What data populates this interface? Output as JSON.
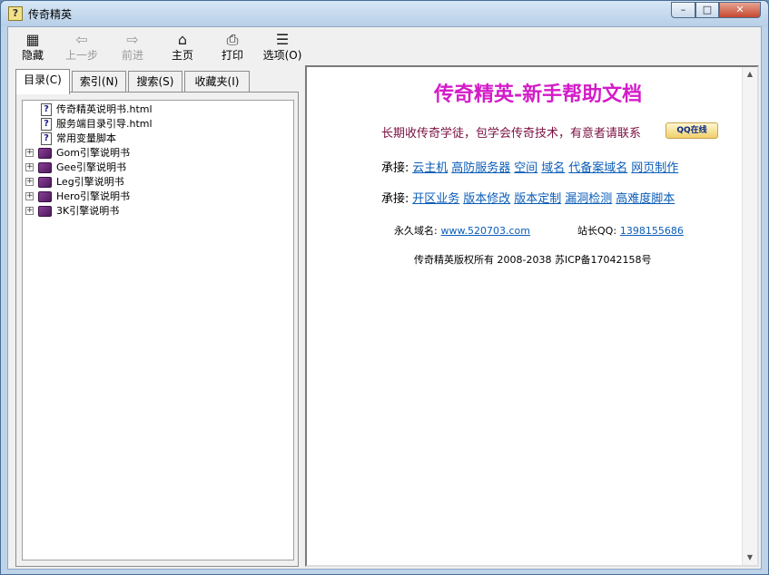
{
  "window": {
    "title": "传奇精英"
  },
  "toolbar": {
    "buttons": [
      {
        "label": "隐藏",
        "icon": "hide-pane-icon"
      },
      {
        "label": "上一步",
        "icon": "back-arrow-icon"
      },
      {
        "label": "前进",
        "icon": "forward-arrow-icon"
      },
      {
        "label": "主页",
        "icon": "home-icon"
      },
      {
        "label": "打印",
        "icon": "print-icon"
      },
      {
        "label": "选项(O)",
        "icon": "options-icon"
      }
    ]
  },
  "tabs": [
    {
      "label": "目录(C)"
    },
    {
      "label": "索引(N)"
    },
    {
      "label": "搜索(S)"
    },
    {
      "label": "收藏夹(I)"
    }
  ],
  "tree": [
    {
      "label": "传奇精英说明书.html",
      "icon": "help-page-icon",
      "expandable": false
    },
    {
      "label": "服务端目录引导.html",
      "icon": "help-page-icon",
      "expandable": false
    },
    {
      "label": "常用变量脚本",
      "icon": "help-page-icon",
      "expandable": false
    },
    {
      "label": "Gom引擎说明书",
      "icon": "book-icon",
      "expandable": true
    },
    {
      "label": "Gee引擎说明书",
      "icon": "book-icon",
      "expandable": true
    },
    {
      "label": "Leg引擎说明书",
      "icon": "book-icon",
      "expandable": true
    },
    {
      "label": "Hero引擎说明书",
      "icon": "book-icon",
      "expandable": true
    },
    {
      "label": "3K引擎说明书",
      "icon": "book-icon",
      "expandable": true
    }
  ],
  "content": {
    "heading": "传奇精英-新手帮助文档",
    "recruit_text": "长期收传奇学徒，包学会传奇技术，有意者请联系",
    "qq_badge": "QQ在线",
    "service_label": "承接:",
    "service_links_1": [
      "云主机",
      "高防服务器",
      "空间",
      "域名",
      "代备案域名",
      "网页制作"
    ],
    "service_links_2": [
      "开区业务",
      "版本修改",
      "版本定制",
      "漏洞检测",
      "高难度脚本"
    ],
    "domain_label": "永久域名:",
    "domain_value": "www.520703.com",
    "qq_label": "站长QQ:",
    "qq_value": "1398155686",
    "copyright": "传奇精英版权所有 2008-2038 苏ICP备17042158号"
  }
}
